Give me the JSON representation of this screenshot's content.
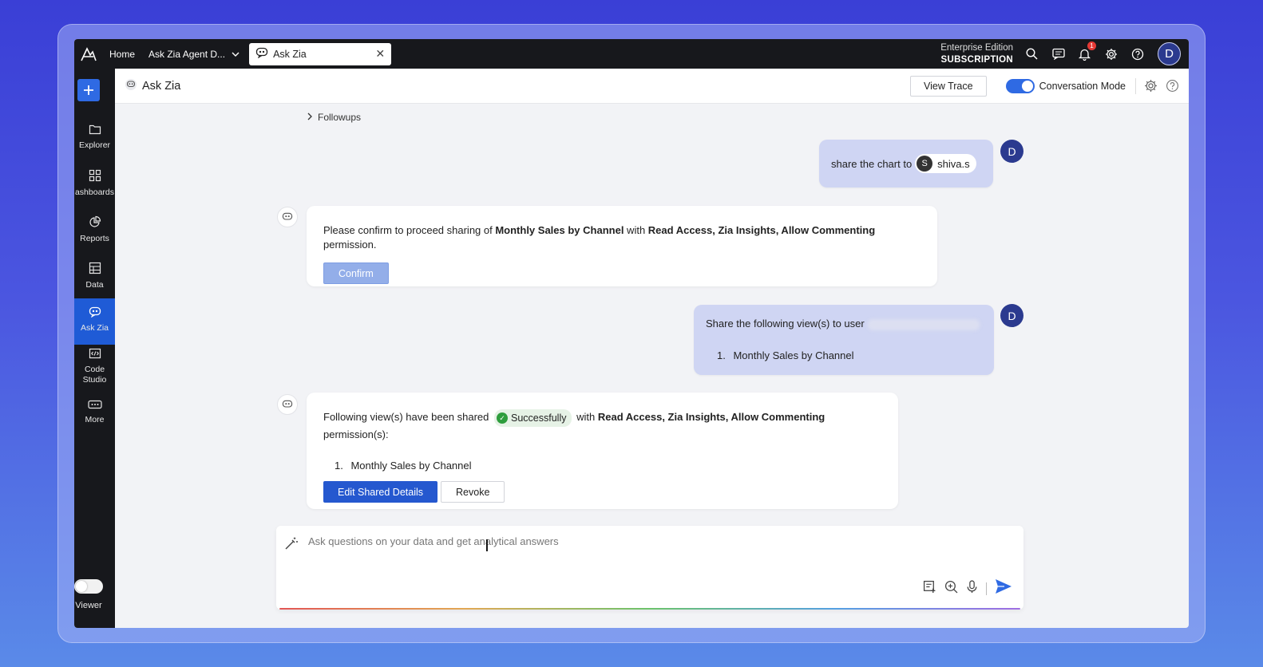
{
  "topbar": {
    "home_label": "Home",
    "workspace_label": "Ask Zia Agent D...",
    "active_tab_label": "Ask Zia",
    "edition_line1": "Enterprise Edition",
    "edition_line2": "SUBSCRIPTION",
    "notification_count": "1",
    "avatar_initial": "D"
  },
  "sidebar": {
    "items": [
      {
        "label": "Explorer",
        "icon": "folder-icon"
      },
      {
        "label": "ashboards",
        "icon": "dashboards-icon"
      },
      {
        "label": "Reports",
        "icon": "reports-icon"
      },
      {
        "label": "Data",
        "icon": "table-icon"
      },
      {
        "label": "Ask Zia",
        "icon": "zia-icon"
      },
      {
        "label": "Code\nStudio",
        "label_line1": "Code",
        "label_line2": "Studio",
        "icon": "code-icon"
      },
      {
        "label": "More",
        "icon": "more-icon"
      }
    ],
    "viewer_label": "Viewer",
    "active_color": "#1f5bd6"
  },
  "header": {
    "title": "Ask Zia",
    "view_trace_label": "View Trace",
    "conversation_mode_label": "Conversation Mode"
  },
  "chat": {
    "followups_label": "Followups",
    "msg1": {
      "text": "share the chart to",
      "mention_initial": "S",
      "mention_name": "shiva.s",
      "avatar": "D"
    },
    "bot1": {
      "prefix": "Please confirm to proceed sharing of ",
      "view_name": "Monthly Sales by Channel",
      "middle": " with ",
      "permissions": "Read Access, Zia Insights, Allow Commenting",
      "suffix": " permission.",
      "confirm_label": "Confirm"
    },
    "msg2": {
      "text": "Share the following view(s) to user",
      "list_num": "1.",
      "list_item": "Monthly Sales by Channel",
      "avatar": "D"
    },
    "bot2": {
      "prefix": "Following view(s) have been shared",
      "badge": "Successfully",
      "middle": "with ",
      "permissions": "Read Access, Zia Insights, Allow Commenting",
      "suffix": " permission(s):",
      "list_num": "1.",
      "list_item": "Monthly Sales by Channel",
      "edit_label": "Edit Shared Details",
      "revoke_label": "Revoke"
    }
  },
  "input": {
    "placeholder": "Ask questions on your data and get analytical answers"
  },
  "colors": {
    "accent": "#2f6ae3",
    "user_bubble": "#cfd5f3",
    "success": "#2e9d3d"
  }
}
